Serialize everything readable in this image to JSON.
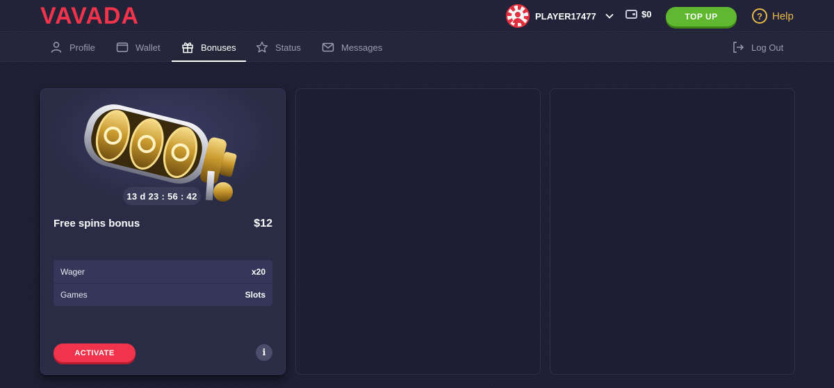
{
  "brand": {
    "logo_text": "VAVADA",
    "accent": "#f1344b"
  },
  "header": {
    "username": "PLAYER17477",
    "balance": "$0",
    "topup_label": "TOP UP",
    "help_label": "Help"
  },
  "nav": {
    "items": [
      {
        "label": "Profile",
        "icon": "user-icon",
        "active": false
      },
      {
        "label": "Wallet",
        "icon": "wallet-icon",
        "active": false
      },
      {
        "label": "Bonuses",
        "icon": "gift-icon",
        "active": true
      },
      {
        "label": "Status",
        "icon": "star-icon",
        "active": false
      },
      {
        "label": "Messages",
        "icon": "mail-icon",
        "active": false
      }
    ],
    "logout_label": "Log Out"
  },
  "bonus_card": {
    "timer": "13 d 23 : 56 : 42",
    "title": "Free spins bonus",
    "amount": "$12",
    "props": [
      {
        "label": "Wager",
        "value": "x20"
      },
      {
        "label": "Games",
        "value": "Slots"
      }
    ],
    "activate_label": "ACTIVATE",
    "info_label": "i"
  }
}
